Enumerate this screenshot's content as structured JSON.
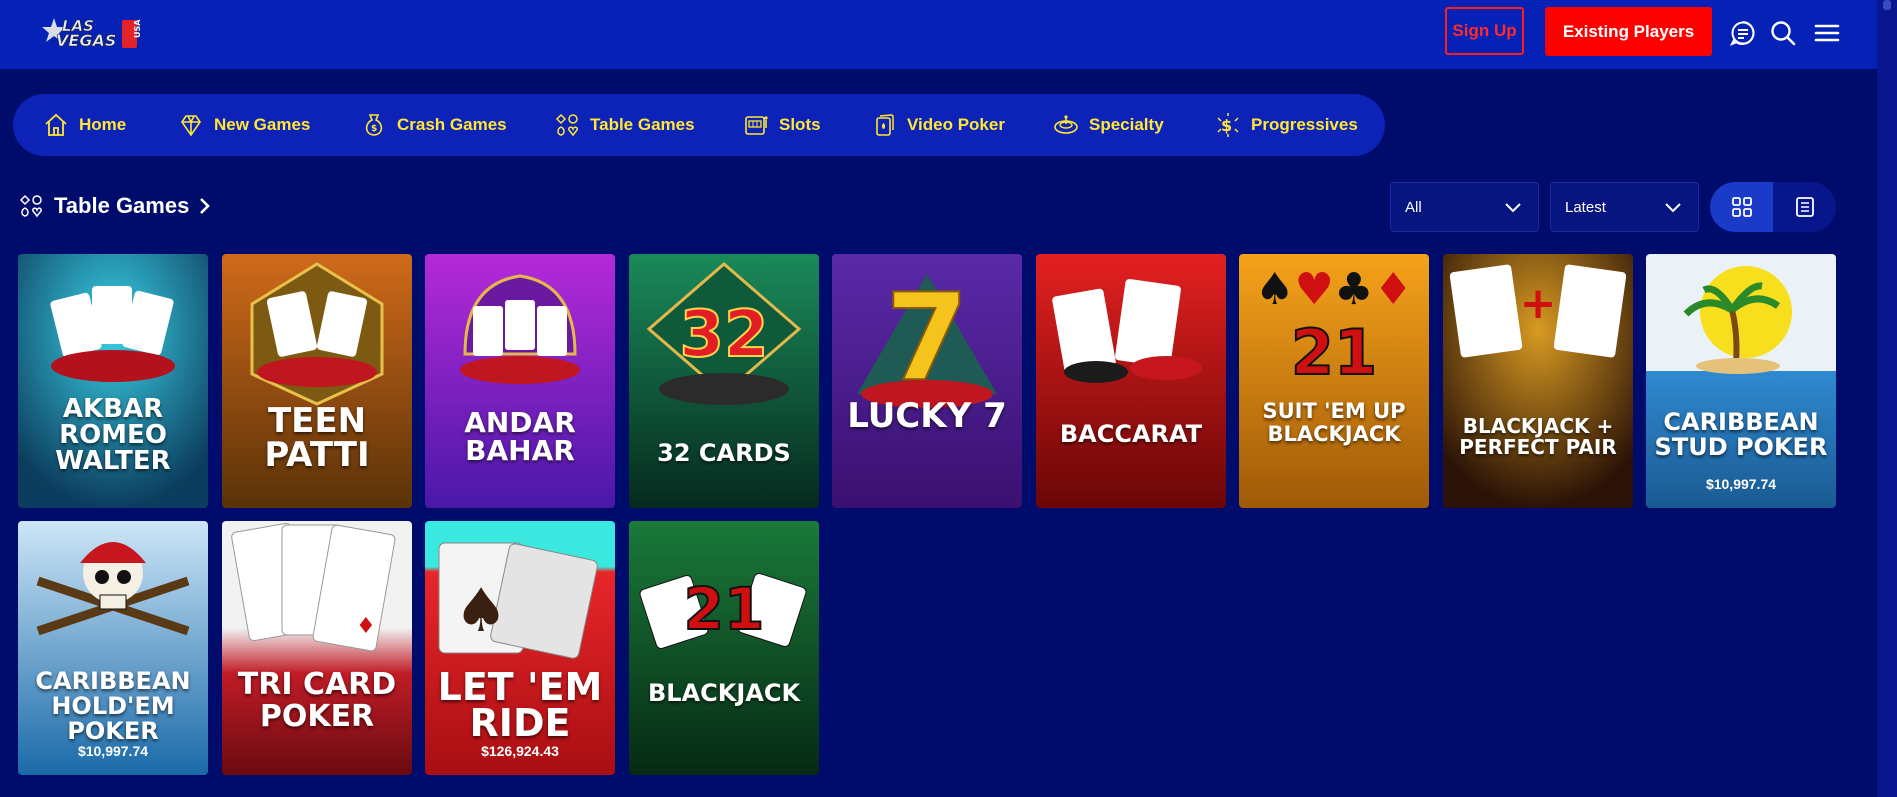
{
  "header": {
    "logo_alt": "LAS VEGAS USA",
    "signup_label": "Sign Up",
    "existing_label": "Existing Players",
    "icons": [
      "chat-icon",
      "search-icon",
      "menu-icon"
    ]
  },
  "nav": {
    "items": [
      {
        "label": "Home",
        "icon": "home-icon"
      },
      {
        "label": "New Games",
        "icon": "diamond-icon"
      },
      {
        "label": "Crash Games",
        "icon": "money-bag-icon"
      },
      {
        "label": "Table Games",
        "icon": "card-suits-icon"
      },
      {
        "label": "Slots",
        "icon": "slot-machine-icon"
      },
      {
        "label": "Video Poker",
        "icon": "cards-icon"
      },
      {
        "label": "Specialty",
        "icon": "roulette-icon"
      },
      {
        "label": "Progressives",
        "icon": "coin-stack-icon"
      }
    ]
  },
  "section": {
    "title": "Table Games",
    "filter_value": "All",
    "sort_value": "Latest"
  },
  "games": [
    {
      "title": "AKBAR ROMEO WALTER",
      "jackpot": ""
    },
    {
      "title": "TEEN PATTI",
      "jackpot": ""
    },
    {
      "title": "ANDAR BAHAR",
      "jackpot": ""
    },
    {
      "title": "32 CARDS",
      "jackpot": ""
    },
    {
      "title": "LUCKY 7",
      "jackpot": ""
    },
    {
      "title": "BACCARAT",
      "jackpot": ""
    },
    {
      "title": "SUIT 'EM UP BLACKJACK",
      "jackpot": ""
    },
    {
      "title": "BLACKJACK + PERFECT PAIR",
      "jackpot": ""
    },
    {
      "title": "CARIBBEAN STUD POKER",
      "jackpot": "$10,997.74"
    },
    {
      "title": "CARIBBEAN HOLD'EM POKER",
      "jackpot": "$10,997.74"
    },
    {
      "title": "TRI CARD POKER",
      "jackpot": ""
    },
    {
      "title": "LET 'EM RIDE",
      "jackpot": "$126,924.43"
    },
    {
      "title": "BLACKJACK",
      "jackpot": ""
    }
  ],
  "colors": {
    "background": "#000c6b",
    "header": "#0622b6",
    "nav_text": "#ffe733",
    "signup": "#ff1d1d",
    "existing": "#ff0000"
  }
}
